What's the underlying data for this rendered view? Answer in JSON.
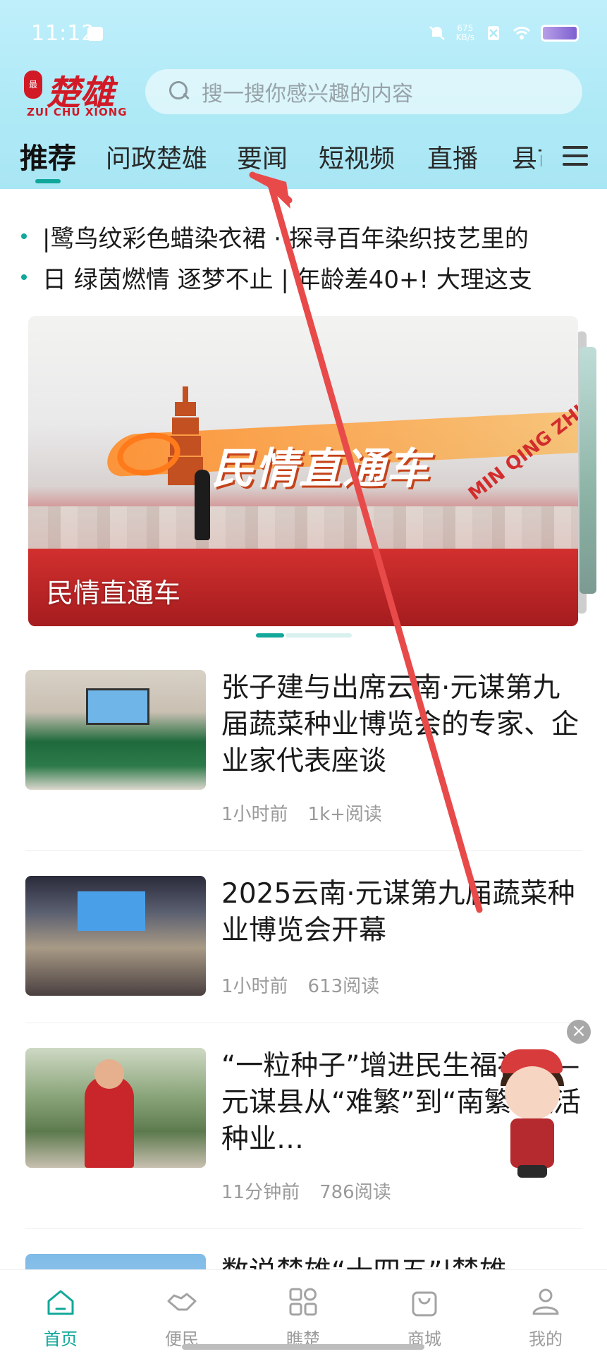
{
  "status_bar": {
    "time": "11:12",
    "net_speed_value": "675",
    "net_speed_unit": "KB/s"
  },
  "header": {
    "logo_text": "楚雄",
    "logo_subtext": "ZUI CHU XIONG",
    "search_placeholder": "搜一搜你感兴趣的内容"
  },
  "tabs": [
    {
      "label": "推荐",
      "active": true
    },
    {
      "label": "问政楚雄",
      "active": false
    },
    {
      "label": "要闻",
      "active": false
    },
    {
      "label": "短视频",
      "active": false
    },
    {
      "label": "直播",
      "active": false
    },
    {
      "label": "县市",
      "active": false
    }
  ],
  "ticker": [
    "|鹭鸟纹彩色蜡染衣裙 · 探寻百年染织技艺里的",
    "日 绿茵燃情 逐梦不止 | 年龄差40+! 大理这支"
  ],
  "banner": {
    "caption": "民情直通车",
    "logo_text": "民情直通车",
    "tilted_text": "MIN QING ZHI TONG CHE"
  },
  "news": [
    {
      "title": "张子建与出席云南·元谋第九届蔬菜种业博览会的专家、企业家代表座谈",
      "time": "1小时前",
      "reads": "1k+阅读"
    },
    {
      "title": "2025云南·元谋第九届蔬菜种业博览会开幕",
      "time": "1小时前",
      "reads": "613阅读"
    },
    {
      "title": "“一粒种子”增进民生福祉——元谋县从“难繁”到“南繁”激活种业…",
      "time": "11分钟前",
      "reads": "786阅读"
    },
    {
      "title": "数说楚雄“十四五”|楚雄",
      "time": "",
      "reads": ""
    }
  ],
  "bottom_nav": [
    {
      "label": "首页",
      "icon": "home-icon",
      "active": true
    },
    {
      "label": "便民",
      "icon": "handshake-icon",
      "active": false
    },
    {
      "label": "瞧楚",
      "icon": "grid-icon",
      "active": false
    },
    {
      "label": "商城",
      "icon": "shopping-bag-icon",
      "active": false
    },
    {
      "label": "我的",
      "icon": "user-icon",
      "active": false
    }
  ],
  "colors": {
    "accent": "#12a89a",
    "header_bg": "#aee9f6",
    "brand_red": "#d11a26",
    "annotation_arrow": "#e84a4a"
  }
}
